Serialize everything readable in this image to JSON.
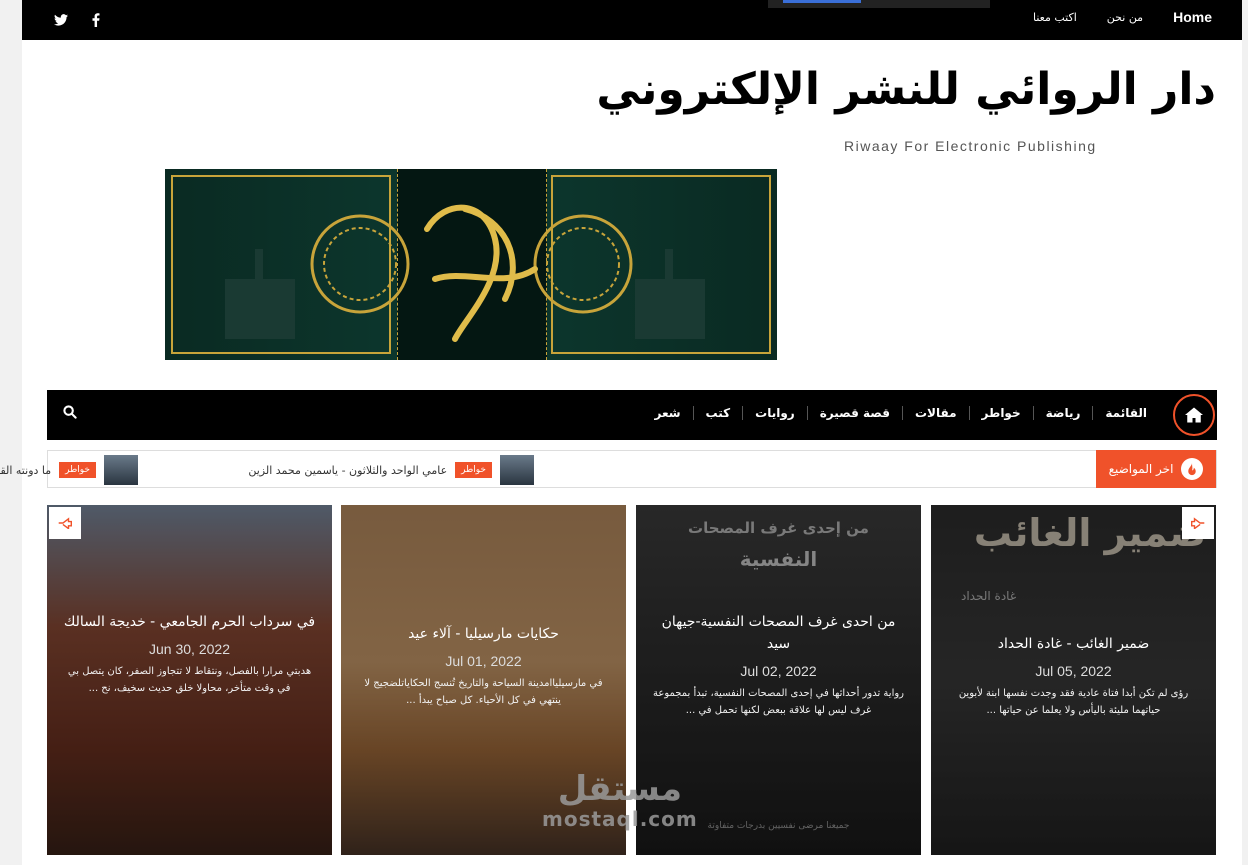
{
  "topbar": {
    "social": [
      "twitter-icon",
      "facebook-icon"
    ],
    "nav": [
      "Home",
      "من نحن",
      "اكتب معنا"
    ]
  },
  "header": {
    "title": "دار الروائي للنشر الإلكتروني",
    "tagline": "Riwaay For Electronic Publishing"
  },
  "mainnav": {
    "home_icon": "home-icon",
    "items": [
      "القائمة",
      "رياضة",
      "خواطر",
      "مقالات",
      "قصة قصيرة",
      "روايات",
      "كتب",
      "شعر"
    ],
    "search_icon": "search-icon"
  },
  "ticker": {
    "label": "اخر المواضيع",
    "items": [
      {
        "badge": "خواطر",
        "text": "عامي الواحد والثلاثون - ياسمين محمد الزين"
      },
      {
        "badge": "خواطر",
        "text": "ما دونته القلوب"
      }
    ]
  },
  "cards": [
    {
      "title": "في سرداب الحرم الجامعي - خديجة السالك",
      "date": "Jun 30, 2022",
      "excerpt": "هدبتي مرارا بالفصل، ونتقاط لا تتجاوز الصفر، كان يتصل بي في وقت متأخر، محاولا خلق حديث سخيف، نح ..."
    },
    {
      "title": "حكايات مارسيليا - آلاء عيد",
      "date": "Jul 01, 2022",
      "excerpt": "في مارسيلياامدينة السياحة والتاريخ تُنسج الحكاياتلضجيج لا ينتهي في كل الأحياء. كل صباح يبدأ ..."
    },
    {
      "title": "من احدى غرف المصحات النفسية-جيهان سيد",
      "date": "Jul 02, 2022",
      "excerpt": "رواية تدور أحداثها في إحدى المصحات النفسية، تبدأ بمجموعة غرف ليس لها علاقة ببعض لكنها تحمل في ...",
      "cover_title": "من إحدى غرف المصحات",
      "cover_subtitle": "النفسية",
      "cover_footer": "جميعنا مرضى نفسيين بدرجات متفاوتة"
    },
    {
      "title": "ضمير الغائب - غادة الحداد",
      "date": "Jul 05, 2022",
      "excerpt": "رؤى لم تكن أبدا فتاة عادية فقد وجدت نفسها ابنة لأبوين حياتهما مليئة باليأس ولا يعلما عن حياتها ...",
      "cover_title": "ضمير الغائب",
      "cover_author": "غادة الحداد"
    }
  ],
  "watermark": {
    "arabic": "مستقل",
    "latin": "mostaql.com"
  },
  "colors": {
    "accent": "#f0522a",
    "nav_bg": "#000000",
    "banner_gold": "#c8a43a"
  }
}
